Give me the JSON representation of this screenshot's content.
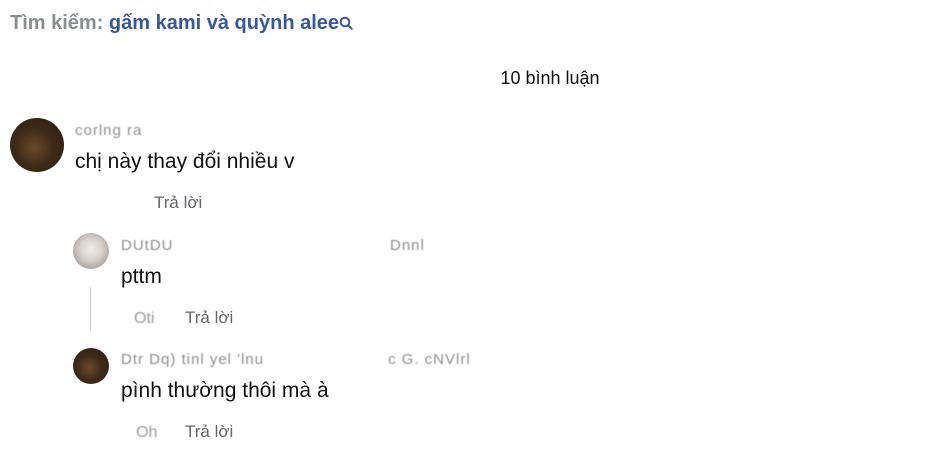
{
  "search": {
    "prefix": "Tìm kiếm:",
    "query": "gấm kami và quỳnh alee",
    "icon": "search-icon"
  },
  "comments_count": "10 bình luận",
  "comment": {
    "author": "corlng ra",
    "text": "chị này thay đổi nhiều v",
    "reply_label": "Trả lời"
  },
  "replies": [
    {
      "author": "DUtDU",
      "author_extra": "Dnnl",
      "text": "pttm",
      "meta_faded": "Oti",
      "reply_label": "Trả lời"
    },
    {
      "author": "Dtr Dq) tinl yel 'lnu",
      "author_extra": "c     G.   cNVlrl",
      "text": "pình thường thôi mà à",
      "meta_faded": "Oh",
      "reply_label": "Trả lời"
    }
  ]
}
